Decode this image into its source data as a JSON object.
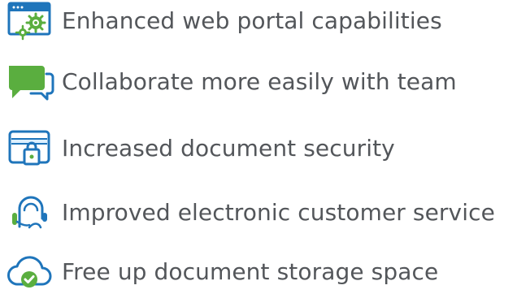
{
  "colors": {
    "text": "#53565a",
    "blue": "#1f75bb",
    "green": "#5aae3f",
    "accent_light_blue": "#dcefff"
  },
  "features": [
    {
      "label": "Enhanced web portal capabilities",
      "icon": "browser-gears-icon"
    },
    {
      "label": "Collaborate more easily with team",
      "icon": "chat-bubbles-icon"
    },
    {
      "label": "Increased document security",
      "icon": "card-lock-icon"
    },
    {
      "label": "Improved electronic customer service",
      "icon": "customer-service-headset-icon"
    },
    {
      "label": "Free up document storage space",
      "icon": "cloud-check-icon"
    }
  ]
}
